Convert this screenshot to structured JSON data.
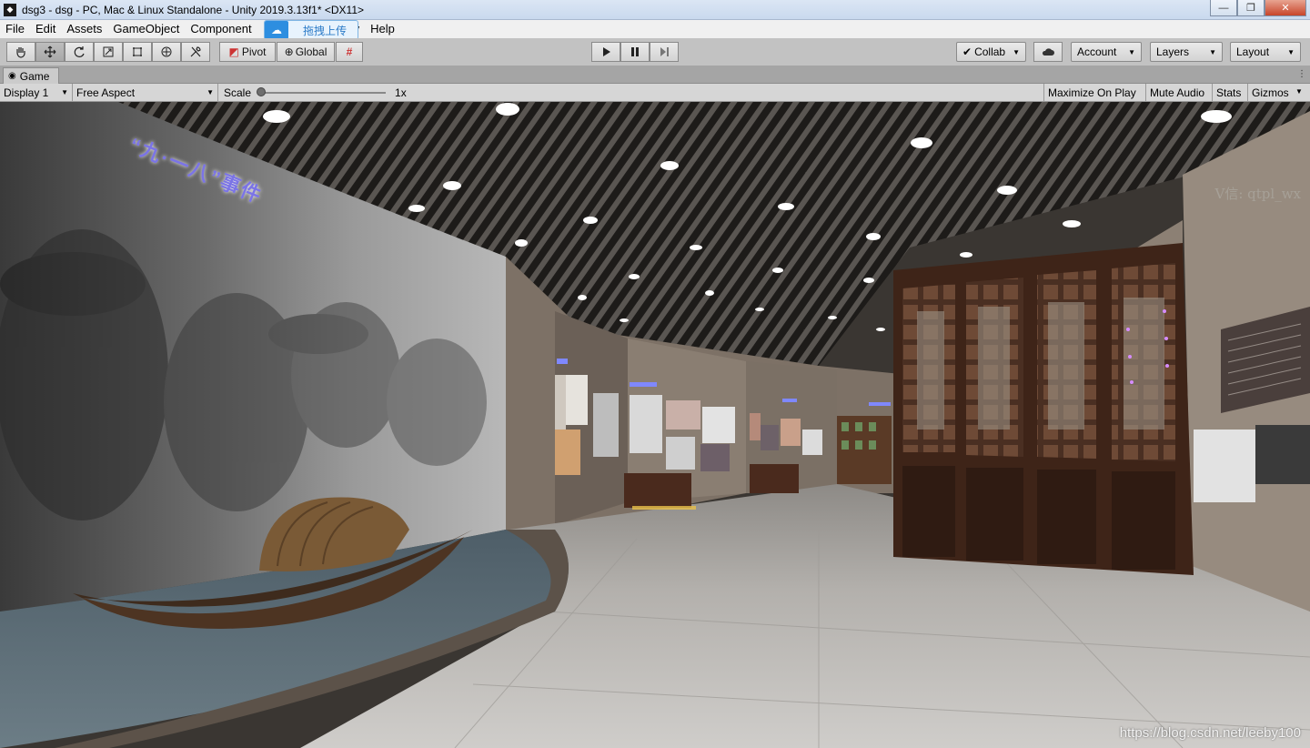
{
  "window": {
    "title": "dsg3 - dsg - PC, Mac & Linux Standalone - Unity 2019.3.13f1* <DX11>",
    "controls": {
      "minimize": "—",
      "maximize": "❐",
      "close": "✕"
    }
  },
  "menu": {
    "items": [
      "File",
      "Edit",
      "Assets",
      "GameObject",
      "Component",
      "y",
      "Help"
    ]
  },
  "upload_overlay": {
    "label": "拖拽上传"
  },
  "toolbar": {
    "pivot_label": "Pivot",
    "global_label": "Global",
    "collab_label": "Collab",
    "account_label": "Account",
    "layers_label": "Layers",
    "layout_label": "Layout"
  },
  "game_tab": {
    "label": "Game"
  },
  "game_bar": {
    "display": "Display 1",
    "aspect": "Free Aspect",
    "scale_label": "Scale",
    "scale_value": "1x",
    "scale_level": 0.0,
    "maximize_on_play": "Maximize On Play",
    "mute_audio": "Mute Audio",
    "stats": "Stats",
    "gizmos": "Gizmos"
  },
  "scene": {
    "banner_text": "“九·一八”事件",
    "watermark_top": "V信: qtpl_wx",
    "watermark_bottom": "https://blog.csdn.net/leeby100"
  },
  "colors": {
    "editor_bg": "#c2c2c2",
    "title_bar": "#c9d9ee",
    "banner_text": "#7b74e6"
  }
}
